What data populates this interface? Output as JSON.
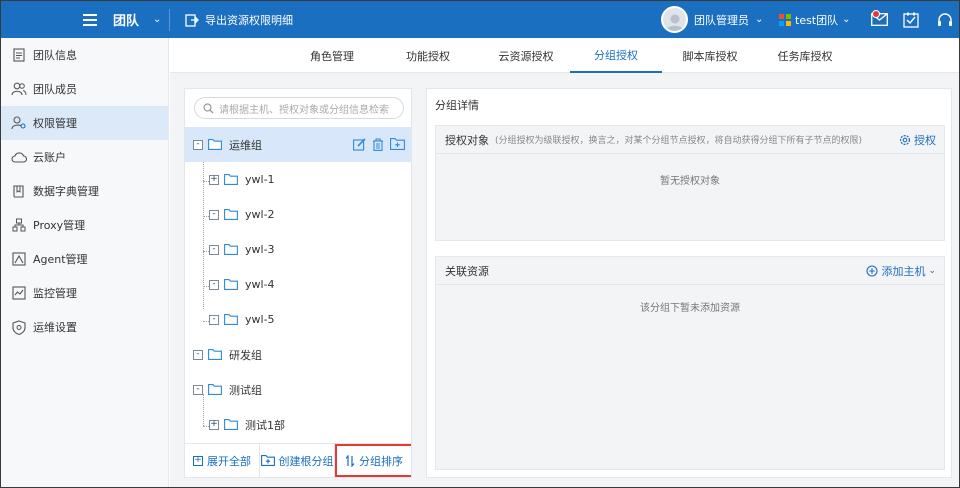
{
  "topbar": {
    "team_label": "团队",
    "export_label": "导出资源权限明细",
    "user_label": "团队管理员",
    "team_select": "test团队"
  },
  "sidebar": {
    "items": [
      {
        "label": "团队信息",
        "icon": "document-icon"
      },
      {
        "label": "团队成员",
        "icon": "users-icon"
      },
      {
        "label": "权限管理",
        "icon": "user-key-icon"
      },
      {
        "label": "云账户",
        "icon": "cloud-icon"
      },
      {
        "label": "数据字典管理",
        "icon": "book-icon"
      },
      {
        "label": "Proxy管理",
        "icon": "network-icon"
      },
      {
        "label": "Agent管理",
        "icon": "agent-icon"
      },
      {
        "label": "监控管理",
        "icon": "monitor-icon"
      },
      {
        "label": "运维设置",
        "icon": "shield-gear-icon"
      }
    ],
    "active_index": 2
  },
  "tabs": [
    "角色管理",
    "功能授权",
    "云资源授权",
    "分组授权",
    "脚本库授权",
    "任务库授权"
  ],
  "active_tab": 3,
  "tree": {
    "search_placeholder": "请根据主机、授权对象或分组信息检索",
    "nodes": [
      {
        "label": "运维组",
        "level": 0,
        "toggle": "-",
        "selected": true
      },
      {
        "label": "ywl-1",
        "level": 1,
        "toggle": "+"
      },
      {
        "label": "ywl-2",
        "level": 1,
        "toggle": "-"
      },
      {
        "label": "ywl-3",
        "level": 1,
        "toggle": "-"
      },
      {
        "label": "ywl-4",
        "level": 1,
        "toggle": "-"
      },
      {
        "label": "ywl-5",
        "level": 1,
        "toggle": "-"
      },
      {
        "label": "研发组",
        "level": 0,
        "toggle": "-"
      },
      {
        "label": "测试组",
        "level": 0,
        "toggle": "-"
      },
      {
        "label": "测试1部",
        "level": 1,
        "toggle": "+"
      }
    ],
    "footer": {
      "expand_all": "展开全部",
      "create_root": "创建根分组",
      "sort": "分组排序"
    }
  },
  "detail": {
    "title": "分组详情",
    "auth": {
      "title": "授权对象",
      "note": "(分组授权为级联授权，换言之，对某个分组节点授权，将自动获得分组下所有子节点的权限)",
      "action": "授权",
      "empty": "暂无授权对象"
    },
    "resources": {
      "title": "关联资源",
      "action": "添加主机",
      "empty": "该分组下暂未添加资源"
    }
  },
  "colors": {
    "primary": "#1a6fc0",
    "highlight": "#e53935"
  }
}
